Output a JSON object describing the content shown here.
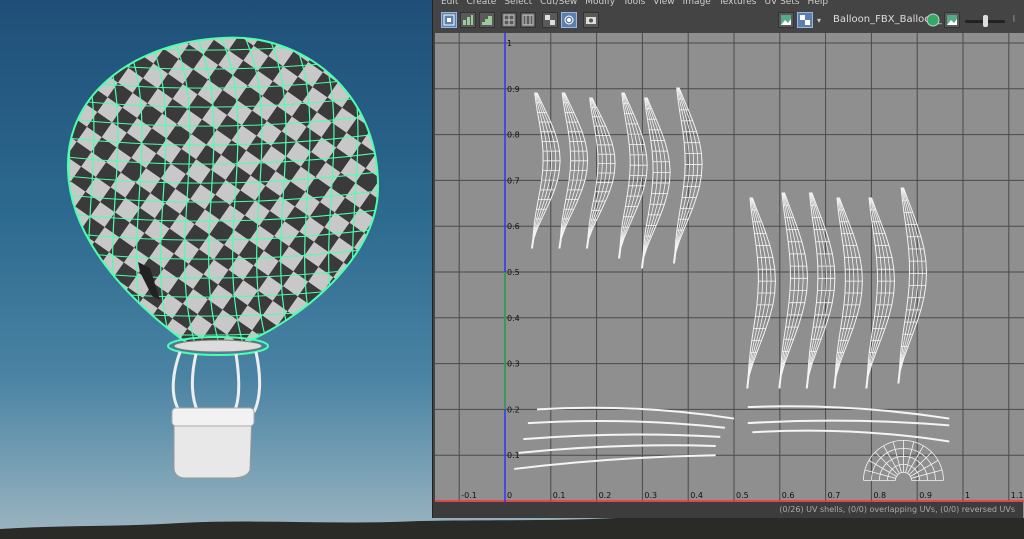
{
  "uv_editor": {
    "menu": [
      "Edit",
      "Create",
      "Select",
      "Cut/Sew",
      "Modify",
      "Tools",
      "View",
      "Image",
      "Textures",
      "UV Sets",
      "Help"
    ],
    "texture_name": "Balloon_FBX_Balloon_",
    "status": "(0/26) UV shells, (0/0) overlapping UVs, (0/0) reversed UVs",
    "u_ticks": [
      "-0.1",
      "0",
      "0.1",
      "0.2",
      "0.3",
      "0.4",
      "0.5",
      "0.6",
      "0.7",
      "0.8",
      "0.9",
      "1",
      "1.1"
    ],
    "v_ticks": [
      "1",
      "0.9",
      "0.8",
      "0.7",
      "0.6",
      "0.5",
      "0.4",
      "0.3",
      "0.2",
      "0.1"
    ]
  },
  "colors": {
    "wireframe": "#4dffb0",
    "uv_wire": "#f4f4f4",
    "grid_bg": "#8f8f8f",
    "axis_u": "#ff3030",
    "axis_v": "#3030ff"
  }
}
